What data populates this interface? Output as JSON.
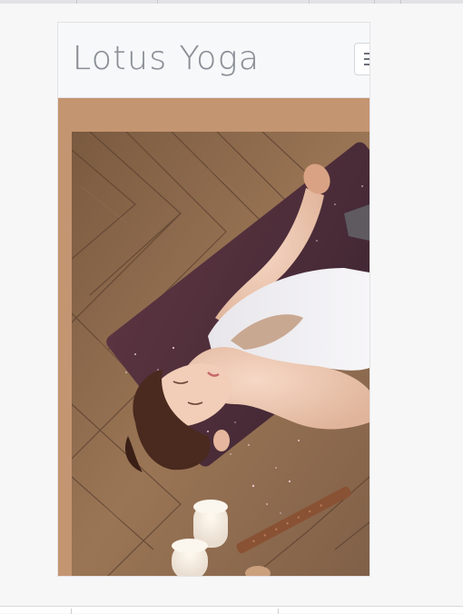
{
  "site": {
    "brand": "Lotus Yoga",
    "menu_icon": "hamburger-menu-icon",
    "accent": "#c49571",
    "brand_color": "#8a8f96"
  },
  "hero": {
    "image": "woman-lying-on-yoga-mat-photo"
  }
}
